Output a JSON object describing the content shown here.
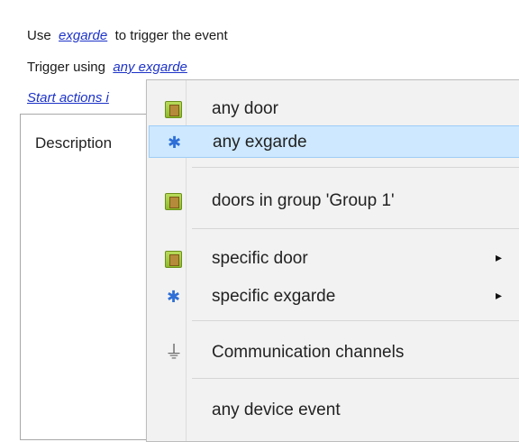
{
  "rule": {
    "use_prefix": "Use",
    "use_link": "exgarde",
    "use_suffix": "to trigger the event",
    "trigger_prefix": "Trigger using",
    "trigger_link": "any exgarde",
    "start_actions_link": "Start actions i"
  },
  "description": {
    "label": "Description"
  },
  "menu": {
    "items": [
      {
        "label": "any door",
        "icon": "door-icon"
      },
      {
        "label": "any exgarde",
        "icon": "puzzle-icon",
        "highlighted": true
      },
      {
        "label": "doors in group 'Group 1'",
        "icon": "door-icon"
      },
      {
        "label": "specific door",
        "icon": "door-icon",
        "submenu": "▸"
      },
      {
        "label": "specific exgarde",
        "icon": "puzzle-icon",
        "submenu": "▸"
      },
      {
        "label": "Communication channels",
        "icon": "plug-icon"
      },
      {
        "label": "any device event"
      }
    ]
  }
}
